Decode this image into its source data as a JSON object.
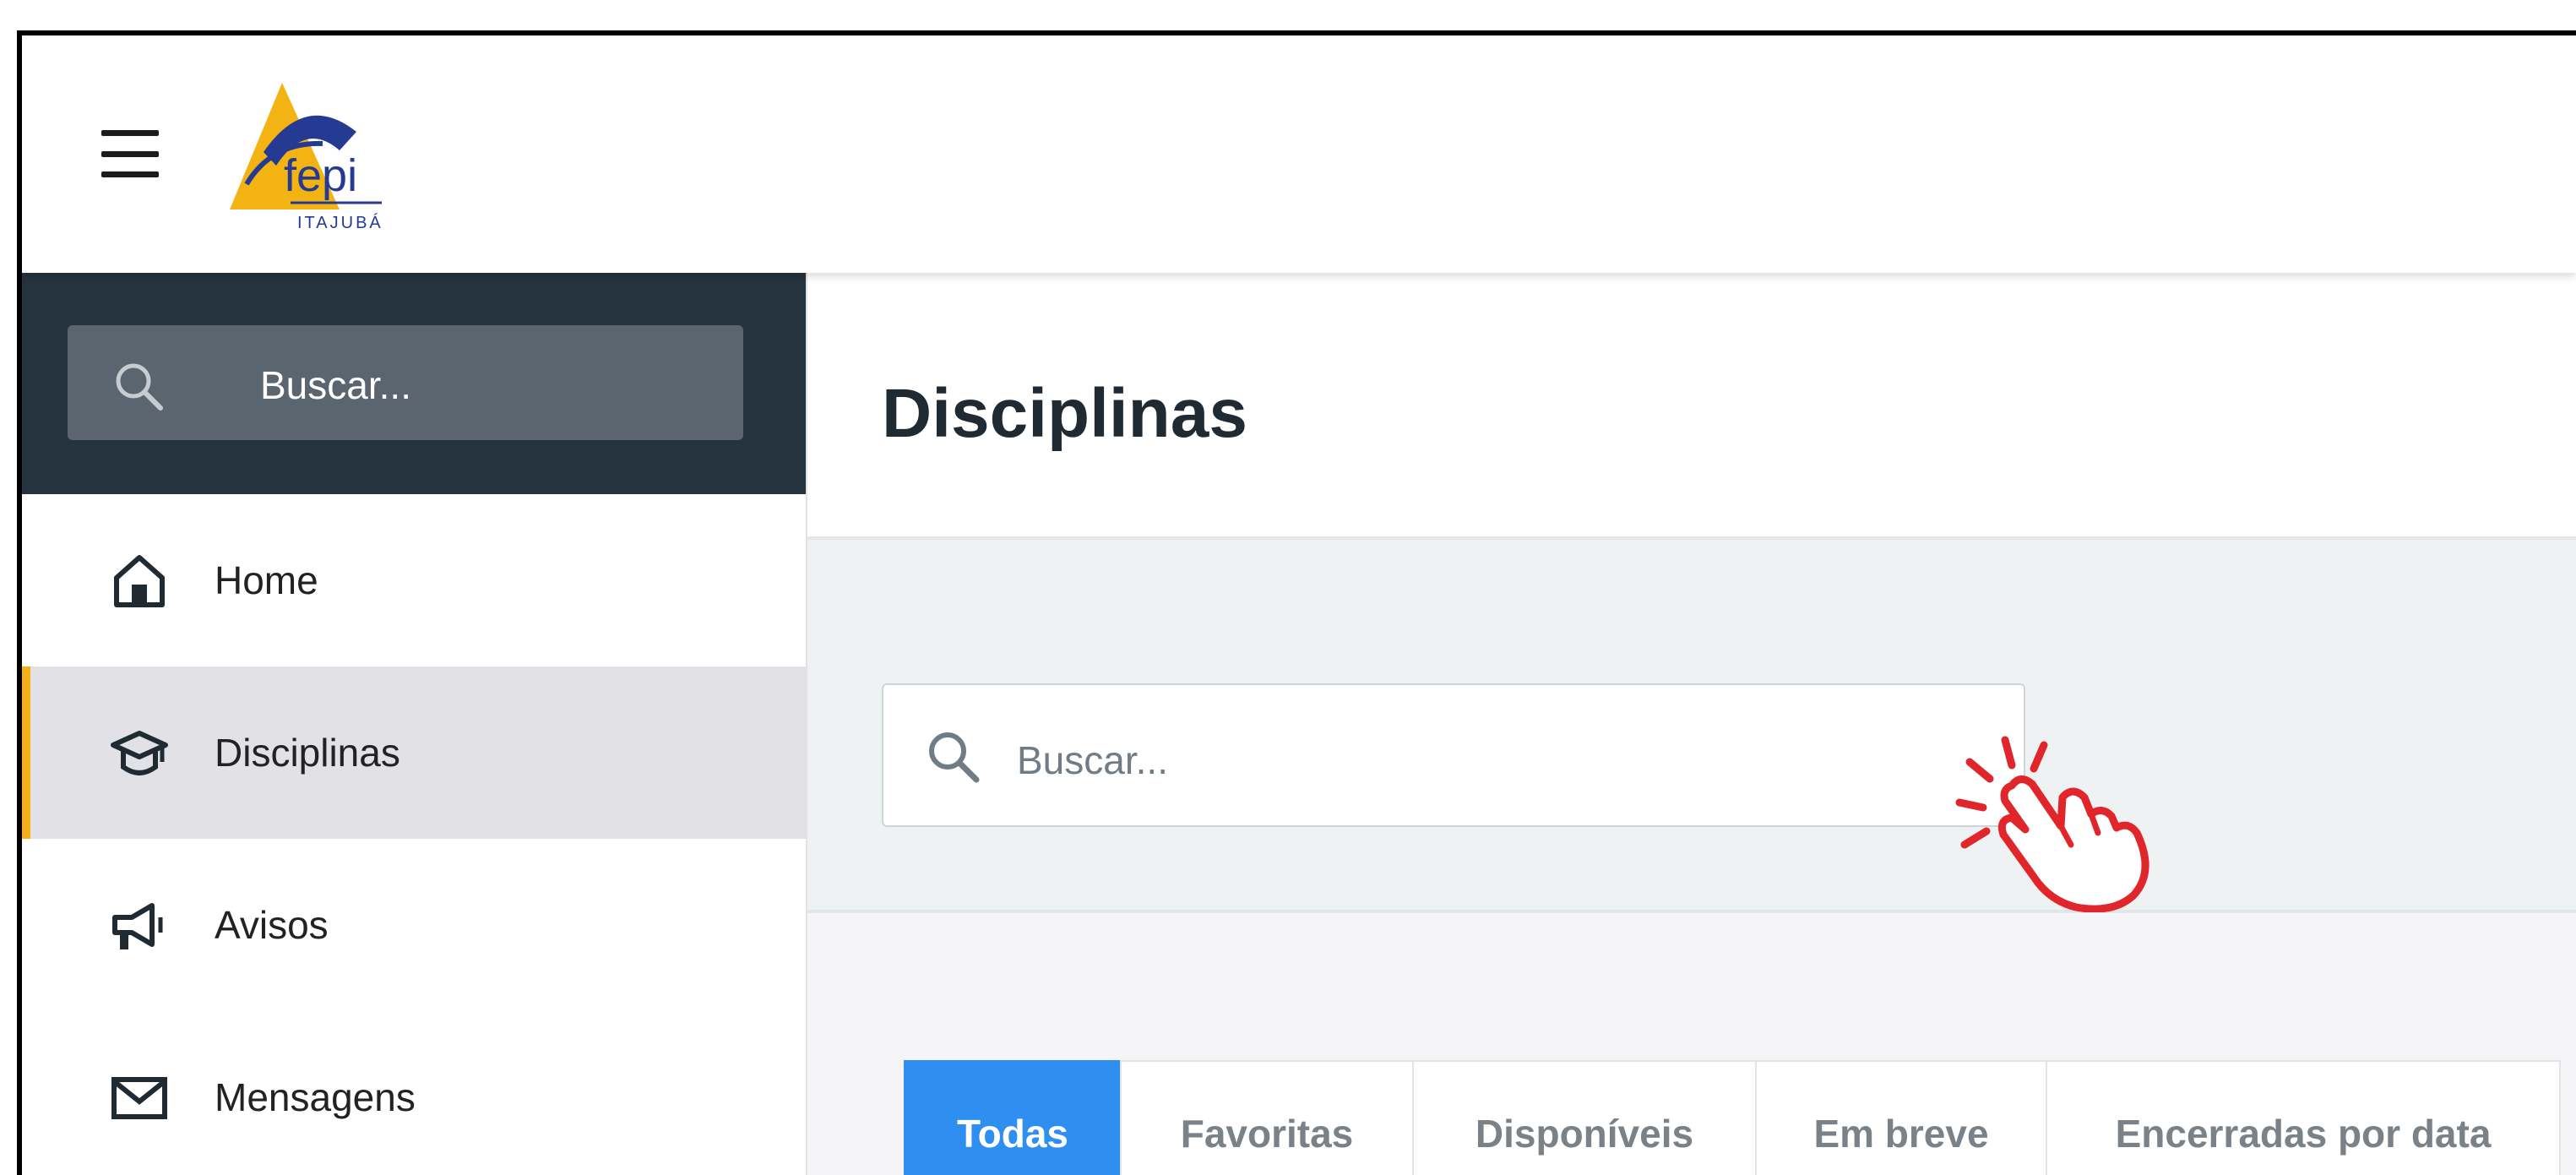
{
  "header": {
    "logo_text": "fepi",
    "logo_subtext": "ITAJUBÁ"
  },
  "sidebar": {
    "search_placeholder": "Buscar...",
    "items": [
      {
        "label": "Home",
        "icon": "home-icon",
        "active": false
      },
      {
        "label": "Disciplinas",
        "icon": "graduation-cap-icon",
        "active": true
      },
      {
        "label": "Avisos",
        "icon": "megaphone-icon",
        "active": false
      },
      {
        "label": "Mensagens",
        "icon": "envelope-icon",
        "active": false
      }
    ]
  },
  "main": {
    "title": "Disciplinas",
    "search_placeholder": "Buscar...",
    "tabs": [
      {
        "label": "Todas",
        "active": true
      },
      {
        "label": "Favoritas",
        "active": false
      },
      {
        "label": "Disponíveis",
        "active": false
      },
      {
        "label": "Em breve",
        "active": false
      },
      {
        "label": "Encerradas por data",
        "active": false
      }
    ]
  },
  "colors": {
    "accent_blue": "#2f8ff0",
    "sidebar_dark": "#25333f",
    "active_marker": "#f4b019",
    "pointer_red": "#e0262b"
  },
  "overlay": {
    "icon": "click-hand-icon"
  }
}
